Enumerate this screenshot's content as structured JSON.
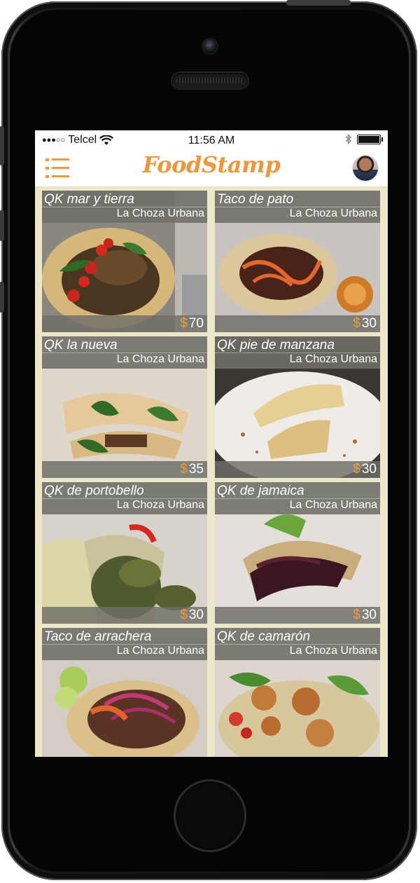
{
  "status_bar": {
    "carrier": "Telcel",
    "time": "11:56 AM"
  },
  "header": {
    "logo": "FoodStamp"
  },
  "icons": {
    "menu": "hamburger-menu-icon",
    "wifi": "wifi-icon",
    "bluetooth": "bluetooth-icon",
    "battery": "battery-icon",
    "avatar": "user-avatar"
  },
  "colors": {
    "accent": "#f09a3c",
    "background": "#ece7c9",
    "card_overlay": "#6e6e66"
  },
  "items": [
    {
      "title": "QK mar y tierra",
      "restaurant": "La Choza Urbana",
      "currency": "$",
      "price": "70"
    },
    {
      "title": "Taco de pato",
      "restaurant": "La Choza Urbana",
      "currency": "$",
      "price": "30"
    },
    {
      "title": "QK la nueva",
      "restaurant": "La Choza Urbana",
      "currency": "$",
      "price": "35"
    },
    {
      "title": "QK pie de manzana",
      "restaurant": "La Choza Urbana",
      "currency": "$",
      "price": "30"
    },
    {
      "title": "QK de portobello",
      "restaurant": "La Choza Urbana",
      "currency": "$",
      "price": "30"
    },
    {
      "title": "QK de jamaica",
      "restaurant": "La Choza Urbana",
      "currency": "$",
      "price": "30"
    },
    {
      "title": "Taco de arrachera",
      "restaurant": "La Choza Urbana",
      "currency": "",
      "price": ""
    },
    {
      "title": "QK de camarón",
      "restaurant": "La Choza Urbana",
      "currency": "",
      "price": ""
    }
  ]
}
